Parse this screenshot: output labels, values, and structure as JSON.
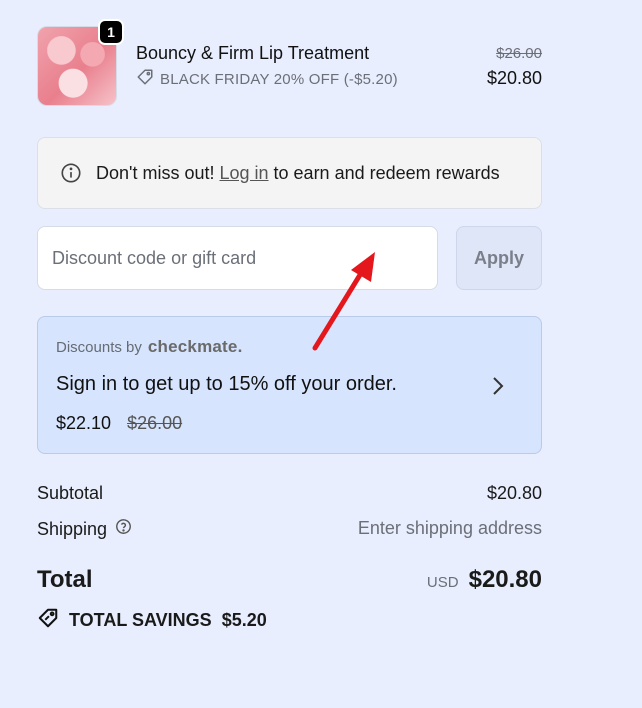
{
  "product": {
    "quantity": "1",
    "title": "Bouncy & Firm Lip Treatment",
    "discount_label": "BLACK FRIDAY 20% OFF (-$5.20)",
    "original_price": "$26.00",
    "price": "$20.80"
  },
  "banner": {
    "before": "Don't miss out!",
    "link": "Log in",
    "after": "to earn and redeem rewards"
  },
  "discount": {
    "placeholder": "Discount code or gift card",
    "apply_label": "Apply"
  },
  "checkmate": {
    "by_label": "Discounts by",
    "brand": "checkmate.",
    "headline": "Sign in to get up to 15% off your order.",
    "price": "$22.10",
    "original_price": "$26.00"
  },
  "summary": {
    "subtotal_label": "Subtotal",
    "subtotal_value": "$20.80",
    "shipping_label": "Shipping",
    "shipping_value": "Enter shipping address",
    "total_label": "Total",
    "currency": "USD",
    "total_value": "$20.80",
    "savings_label": "TOTAL SAVINGS",
    "savings_value": "$5.20"
  },
  "colors": {
    "background": "#e8eefd",
    "checkmate_card": "#d6e4fd",
    "annotation_arrow": "#e3171c"
  }
}
